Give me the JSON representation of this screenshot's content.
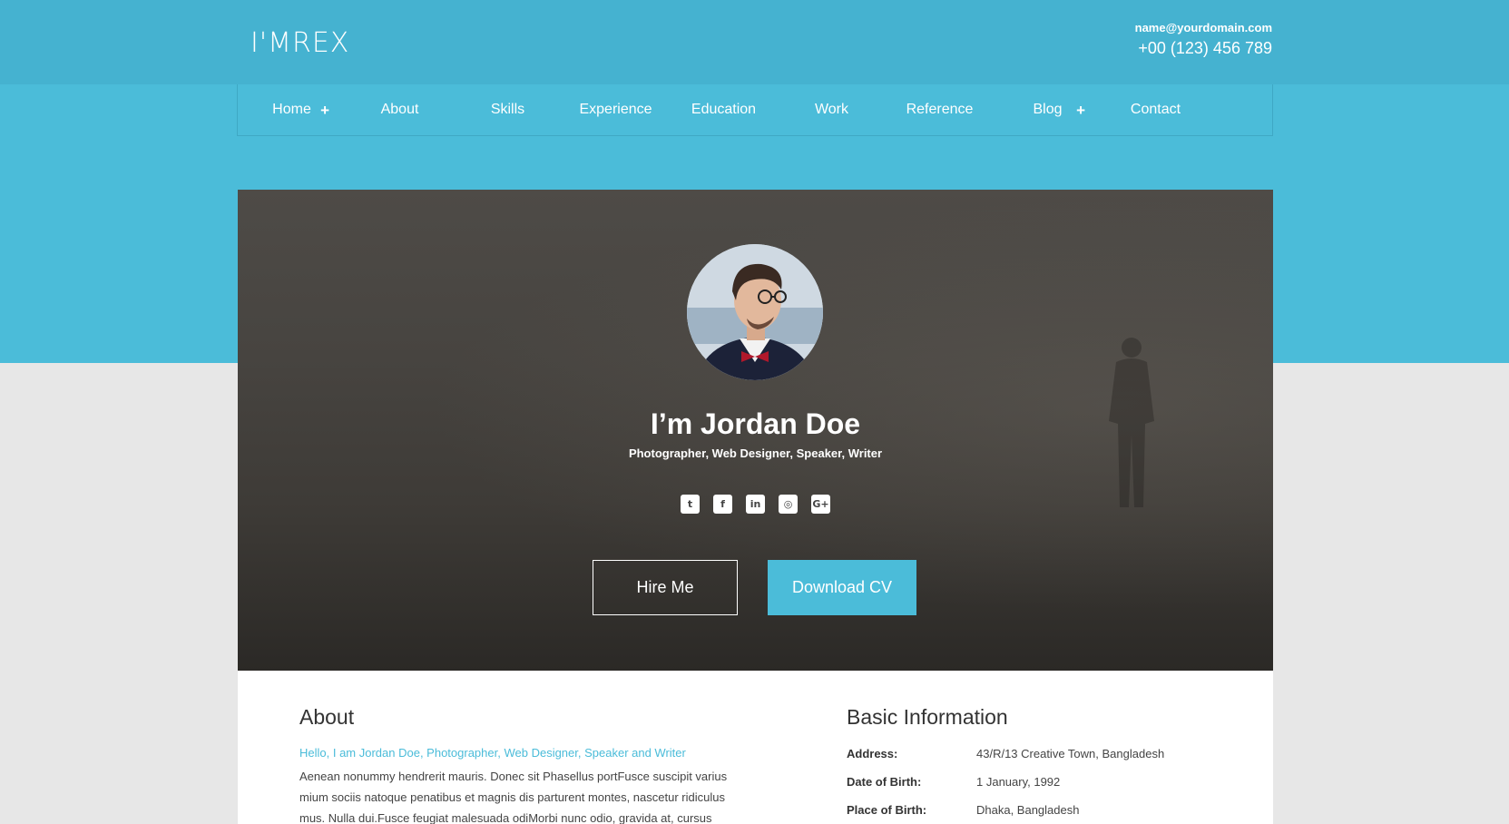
{
  "header": {
    "logo": "I'MREX",
    "email": "name@yourdomain.com",
    "phone": "+00 (123) 456 789"
  },
  "nav": {
    "items": [
      {
        "label": "Home",
        "has_submenu": true
      },
      {
        "label": "About",
        "has_submenu": false
      },
      {
        "label": "Skills",
        "has_submenu": false
      },
      {
        "label": "Experience",
        "has_submenu": false
      },
      {
        "label": "Education",
        "has_submenu": false
      },
      {
        "label": "Work",
        "has_submenu": false
      },
      {
        "label": "Reference",
        "has_submenu": false
      },
      {
        "label": "Blog",
        "has_submenu": true
      },
      {
        "label": "Contact",
        "has_submenu": false
      }
    ],
    "submenu_symbol": "+"
  },
  "hero": {
    "name": "I’m Jordan Doe",
    "role": "Photographer, Web Designer, Speaker, Writer",
    "socials": [
      "twitter-icon",
      "facebook-icon",
      "linkedin-icon",
      "instagram-icon",
      "google-plus-icon"
    ],
    "social_glyphs": [
      "t",
      "f",
      "in",
      "◎",
      "G+"
    ],
    "hire_label": "Hire Me",
    "cv_label": "Download CV"
  },
  "about": {
    "title": "About",
    "intro": "Hello, I am Jordan Doe, Photographer, Web Designer, Speaker and Writer",
    "body": "Aenean nonummy hendrerit mauris. Donec sit Phasellus portFusce suscipit varius mium sociis natoque penatibus et magnis dis parturent montes, nascetur ridiculus mus. Nulla dui.Fusce feugiat malesuada odiMorbi nunc odio, gravida at, cursus"
  },
  "basic_info": {
    "title": "Basic Information",
    "rows": [
      {
        "label": "Address:",
        "value": "43/R/13 Creative Town, Bangladesh"
      },
      {
        "label": "Date of Birth:",
        "value": "1 January, 1992"
      },
      {
        "label": "Place of Birth:",
        "value": "Dhaka, Bangladesh"
      }
    ]
  },
  "colors": {
    "accent": "#4bbcd9",
    "header": "#45b2d0",
    "page_bg": "#e7e7e7"
  }
}
